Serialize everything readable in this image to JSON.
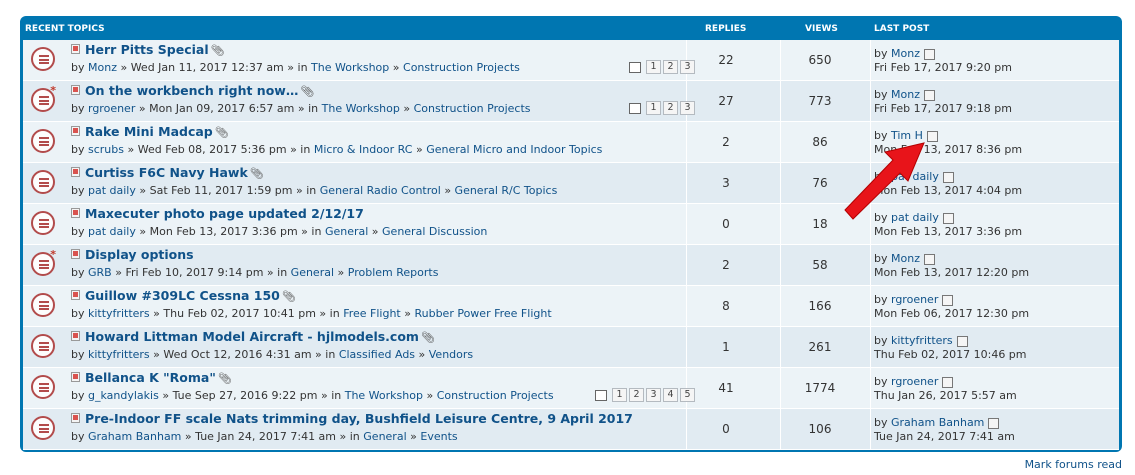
{
  "header": {
    "recent_topics": "RECENT TOPICS",
    "replies": "REPLIES",
    "views": "VIEWS",
    "last_post": "LAST POST"
  },
  "topics": [
    {
      "title": "Herr Pitts Special",
      "icon": "topic-read-icon",
      "attachment": true,
      "author": "Monz",
      "date": "Wed Jan 11, 2017 12:37 am",
      "forum": "The Workshop",
      "subforum": "Construction Projects",
      "pages": [
        "1",
        "2",
        "3"
      ],
      "replies": "22",
      "views": "650",
      "last_author": "Monz",
      "last_date": "Fri Feb 17, 2017 9:20 pm"
    },
    {
      "title": "On the workbench right now…",
      "icon": "topic-mine-icon",
      "attachment": true,
      "author": "rgroener",
      "date": "Mon Jan 09, 2017 6:57 am",
      "forum": "The Workshop",
      "subforum": "Construction Projects",
      "pages": [
        "1",
        "2",
        "3"
      ],
      "replies": "27",
      "views": "773",
      "last_author": "Monz",
      "last_date": "Fri Feb 17, 2017 9:18 pm"
    },
    {
      "title": "Rake Mini Madcap",
      "icon": "topic-read-icon",
      "attachment": true,
      "author": "scrubs",
      "date": "Wed Feb 08, 2017 5:36 pm",
      "forum": "Micro & Indoor RC",
      "subforum": "General Micro and Indoor Topics",
      "pages": [],
      "replies": "2",
      "views": "86",
      "last_author": "Tim H",
      "last_date": "Mon Feb 13, 2017 8:36 pm"
    },
    {
      "title": "Curtiss F6C Navy Hawk",
      "icon": "topic-read-icon",
      "attachment": true,
      "author": "pat daily",
      "date": "Sat Feb 11, 2017 1:59 pm",
      "forum": "General Radio Control",
      "subforum": "General R/C Topics",
      "pages": [],
      "replies": "3",
      "views": "76",
      "last_author": "pat daily",
      "last_date": "Mon Feb 13, 2017 4:04 pm"
    },
    {
      "title": "Maxecuter photo page updated 2/12/17",
      "icon": "topic-read-icon",
      "attachment": false,
      "author": "pat daily",
      "date": "Mon Feb 13, 2017 3:36 pm",
      "forum": "General",
      "subforum": "General Discussion",
      "pages": [],
      "replies": "0",
      "views": "18",
      "last_author": "pat daily",
      "last_date": "Mon Feb 13, 2017 3:36 pm"
    },
    {
      "title": "Display options",
      "icon": "topic-mine-icon",
      "attachment": false,
      "author": "GRB",
      "date": "Fri Feb 10, 2017 9:14 pm",
      "forum": "General",
      "subforum": "Problem Reports",
      "pages": [],
      "replies": "2",
      "views": "58",
      "last_author": "Monz",
      "last_date": "Mon Feb 13, 2017 12:20 pm"
    },
    {
      "title": "Guillow #309LC Cessna 150",
      "icon": "topic-read-icon",
      "attachment": true,
      "author": "kittyfritters",
      "date": "Thu Feb 02, 2017 10:41 pm",
      "forum": "Free Flight",
      "subforum": "Rubber Power Free Flight",
      "pages": [],
      "replies": "8",
      "views": "166",
      "last_author": "rgroener",
      "last_date": "Mon Feb 06, 2017 12:30 pm"
    },
    {
      "title": "Howard Littman Model Aircraft - hjlmodels.com",
      "icon": "topic-read-icon",
      "attachment": true,
      "author": "kittyfritters",
      "date": "Wed Oct 12, 2016 4:31 am",
      "forum": "Classified Ads",
      "subforum": "Vendors",
      "pages": [],
      "replies": "1",
      "views": "261",
      "last_author": "kittyfritters",
      "last_date": "Thu Feb 02, 2017 10:46 pm"
    },
    {
      "title": "Bellanca K \"Roma\"",
      "icon": "topic-read-icon",
      "attachment": true,
      "author": "g_kandylakis",
      "date": "Tue Sep 27, 2016 9:22 pm",
      "forum": "The Workshop",
      "subforum": "Construction Projects",
      "pages": [
        "1",
        "2",
        "3",
        "4",
        "5"
      ],
      "replies": "41",
      "views": "1774",
      "last_author": "rgroener",
      "last_date": "Thu Jan 26, 2017 5:57 am"
    },
    {
      "title": "Pre-Indoor FF scale Nats trimming day, Bushfield Leisure Centre, 9 April 2017",
      "icon": "topic-read-icon",
      "attachment": false,
      "author": "Graham Banham",
      "date": "Tue Jan 24, 2017 7:41 am",
      "forum": "General",
      "subforum": "Events",
      "pages": [],
      "replies": "0",
      "views": "106",
      "last_author": "Graham Banham",
      "last_date": "Tue Jan 24, 2017 7:41 am"
    }
  ],
  "strings": {
    "by": "by",
    "sep": "»",
    "in": "in"
  },
  "footer": {
    "mark_read": "Mark forums read"
  },
  "colors": {
    "accent": "#0076b1",
    "link": "#105289",
    "arrow": "#e8141a"
  }
}
